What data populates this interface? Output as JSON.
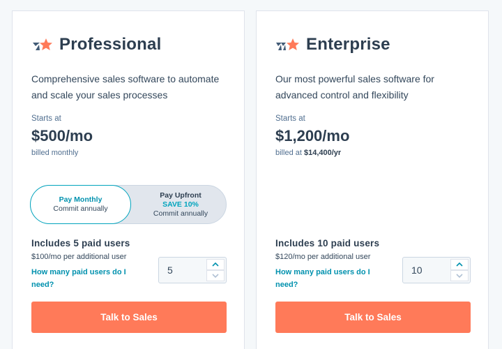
{
  "plans": {
    "professional": {
      "title": "Professional",
      "description": "Comprehensive sales software to automate and scale your sales processes",
      "starts_label": "Starts at",
      "price": "$500/mo",
      "billed": "billed monthly",
      "toggle": {
        "monthly_label": "Pay Monthly",
        "monthly_sub": "Commit annually",
        "upfront_label": "Pay Upfront",
        "upfront_save": "SAVE 10%",
        "upfront_sub": "Commit annually",
        "selected": "monthly"
      },
      "users_heading": "Includes 5 paid users",
      "per_user": "$100/mo per additional user",
      "help_link": "How many paid users do I need?",
      "user_count": "5",
      "cta": "Talk to Sales"
    },
    "enterprise": {
      "title": "Enterprise",
      "description": "Our most powerful sales software for advanced control and flexibility",
      "starts_label": "Starts at",
      "price": "$1,200/mo",
      "billed_prefix": "billed at ",
      "billed_amount": "$14,400/yr",
      "users_heading": "Includes 10 paid users",
      "per_user": "$120/mo per additional user",
      "help_link": "How many paid users do I need?",
      "user_count": "10",
      "cta": "Talk to Sales"
    }
  },
  "colors": {
    "accent_orange": "#ff7a59",
    "teal": "#00a4bd",
    "link": "#0091ae",
    "heading": "#2d3e50",
    "logo_dark": "#425b76",
    "logo_orange": "#ff7a59"
  },
  "icons": {
    "professional_logo": "professional-tier-icon",
    "enterprise_logo": "enterprise-tier-icon",
    "stepper_up": "chevron-up-icon",
    "stepper_down": "chevron-down-icon"
  }
}
